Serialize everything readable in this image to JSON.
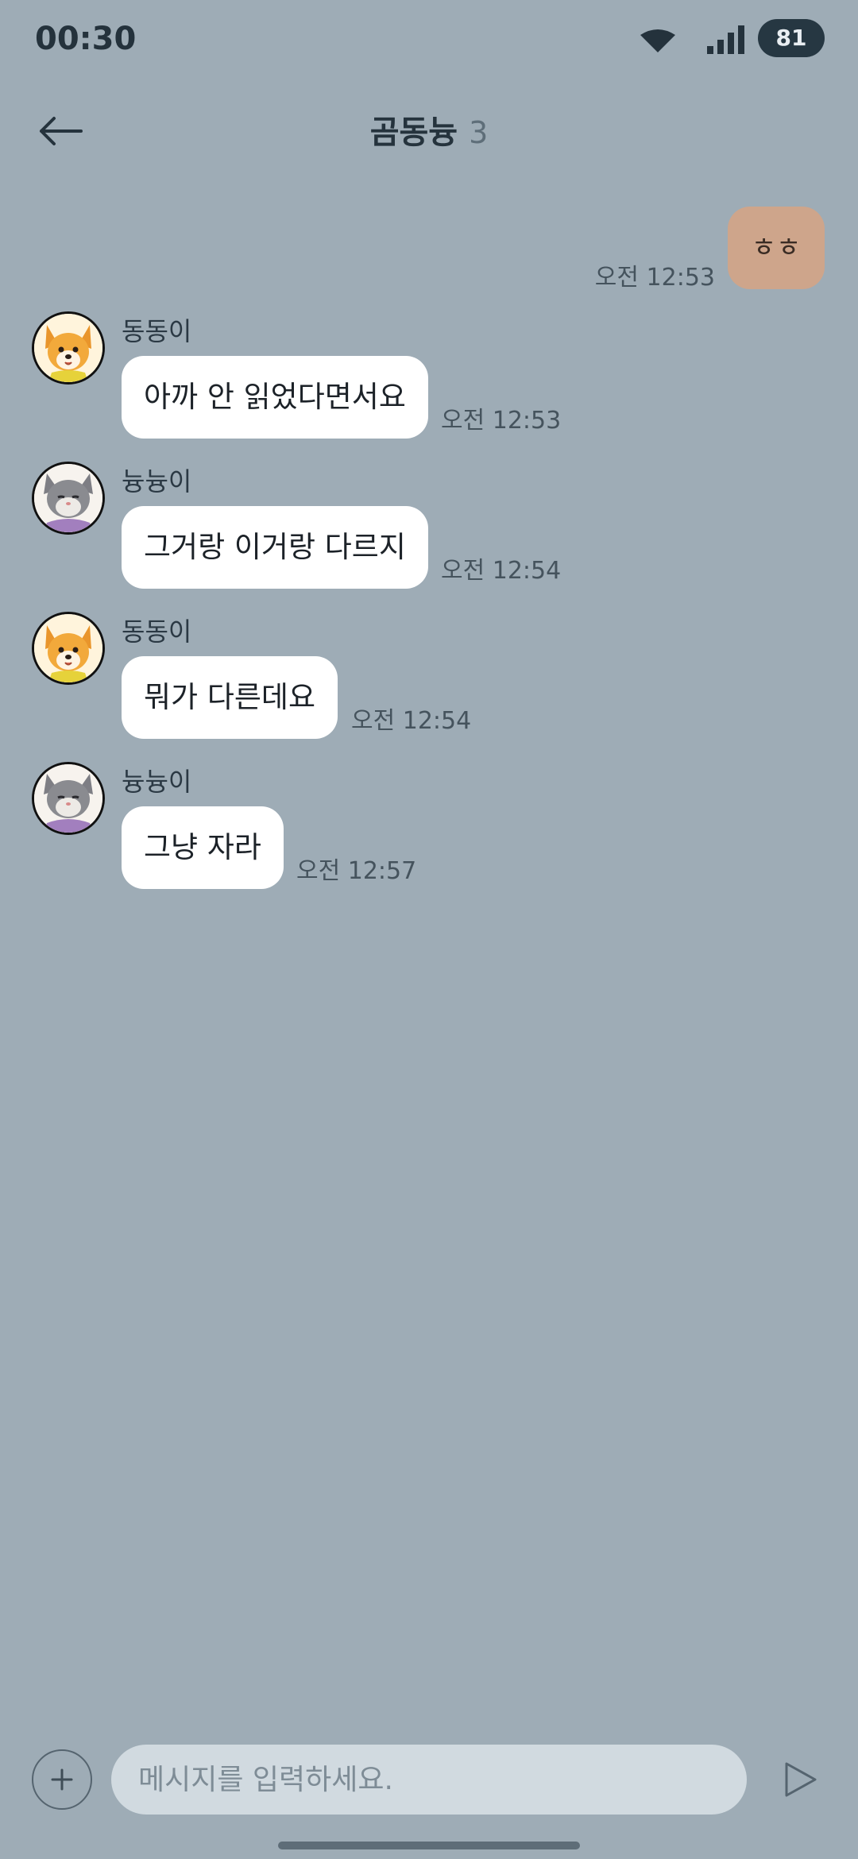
{
  "status_bar": {
    "time": "00:30",
    "battery": "81",
    "icons": [
      "wifi-icon",
      "signal-icon"
    ]
  },
  "header": {
    "title": "곰동늉",
    "member_count": "3",
    "back_icon": "arrow-left-icon"
  },
  "messages": [
    {
      "type": "outgoing",
      "text": "ㅎㅎ",
      "time": "오전 12:53"
    },
    {
      "type": "incoming",
      "sender": "동동이",
      "avatar": "dog-avatar",
      "text": "아까 안 읽었다면서요",
      "time": "오전 12:53"
    },
    {
      "type": "incoming",
      "sender": "늉늉이",
      "avatar": "cat-avatar",
      "text": "그거랑 이거랑 다르지",
      "time": "오전 12:54"
    },
    {
      "type": "incoming",
      "sender": "동동이",
      "avatar": "dog-avatar",
      "text": "뭐가 다른데요",
      "time": "오전 12:54"
    },
    {
      "type": "incoming",
      "sender": "늉늉이",
      "avatar": "cat-avatar",
      "text": "그냥 자라",
      "time": "오전 12:57"
    }
  ],
  "input": {
    "placeholder": "메시지를 입력하세요.",
    "value": "",
    "plus_icon": "plus-icon",
    "send_icon": "send-icon"
  },
  "colors": {
    "background": "#9EACB6",
    "my_bubble": "#CEA58B",
    "their_bubble": "#FFFFFF",
    "input_field": "#D1DAE0",
    "battery_badge": "#263742"
  }
}
